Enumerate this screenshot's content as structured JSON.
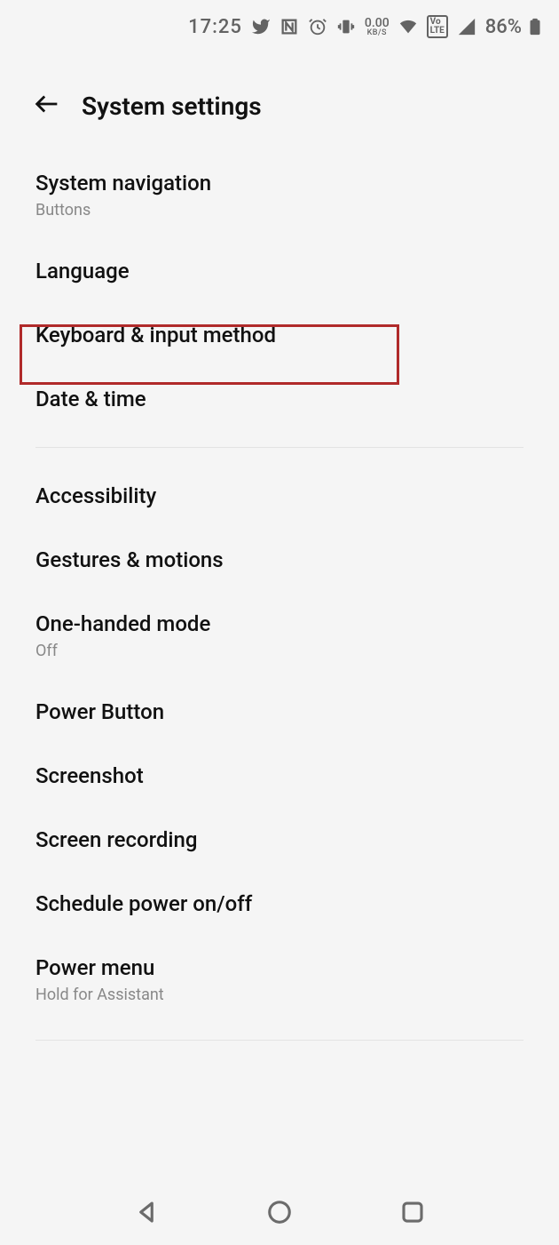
{
  "status": {
    "time": "17:25",
    "net_speed_value": "0.00",
    "net_speed_unit": "KB/S",
    "volte": "Vo LTE",
    "battery_percent": "86%"
  },
  "header": {
    "title": "System settings"
  },
  "items": {
    "system_navigation": {
      "label": "System navigation",
      "sub": "Buttons"
    },
    "language": {
      "label": "Language"
    },
    "keyboard": {
      "label": "Keyboard & input method"
    },
    "date_time": {
      "label": "Date & time"
    },
    "accessibility": {
      "label": "Accessibility"
    },
    "gestures": {
      "label": "Gestures & motions"
    },
    "one_handed": {
      "label": "One-handed mode",
      "sub": "Off"
    },
    "power_button": {
      "label": "Power Button"
    },
    "screenshot": {
      "label": "Screenshot"
    },
    "screen_recording": {
      "label": "Screen recording"
    },
    "schedule_power": {
      "label": "Schedule power on/off"
    },
    "power_menu": {
      "label": "Power menu",
      "sub": "Hold for Assistant"
    }
  }
}
